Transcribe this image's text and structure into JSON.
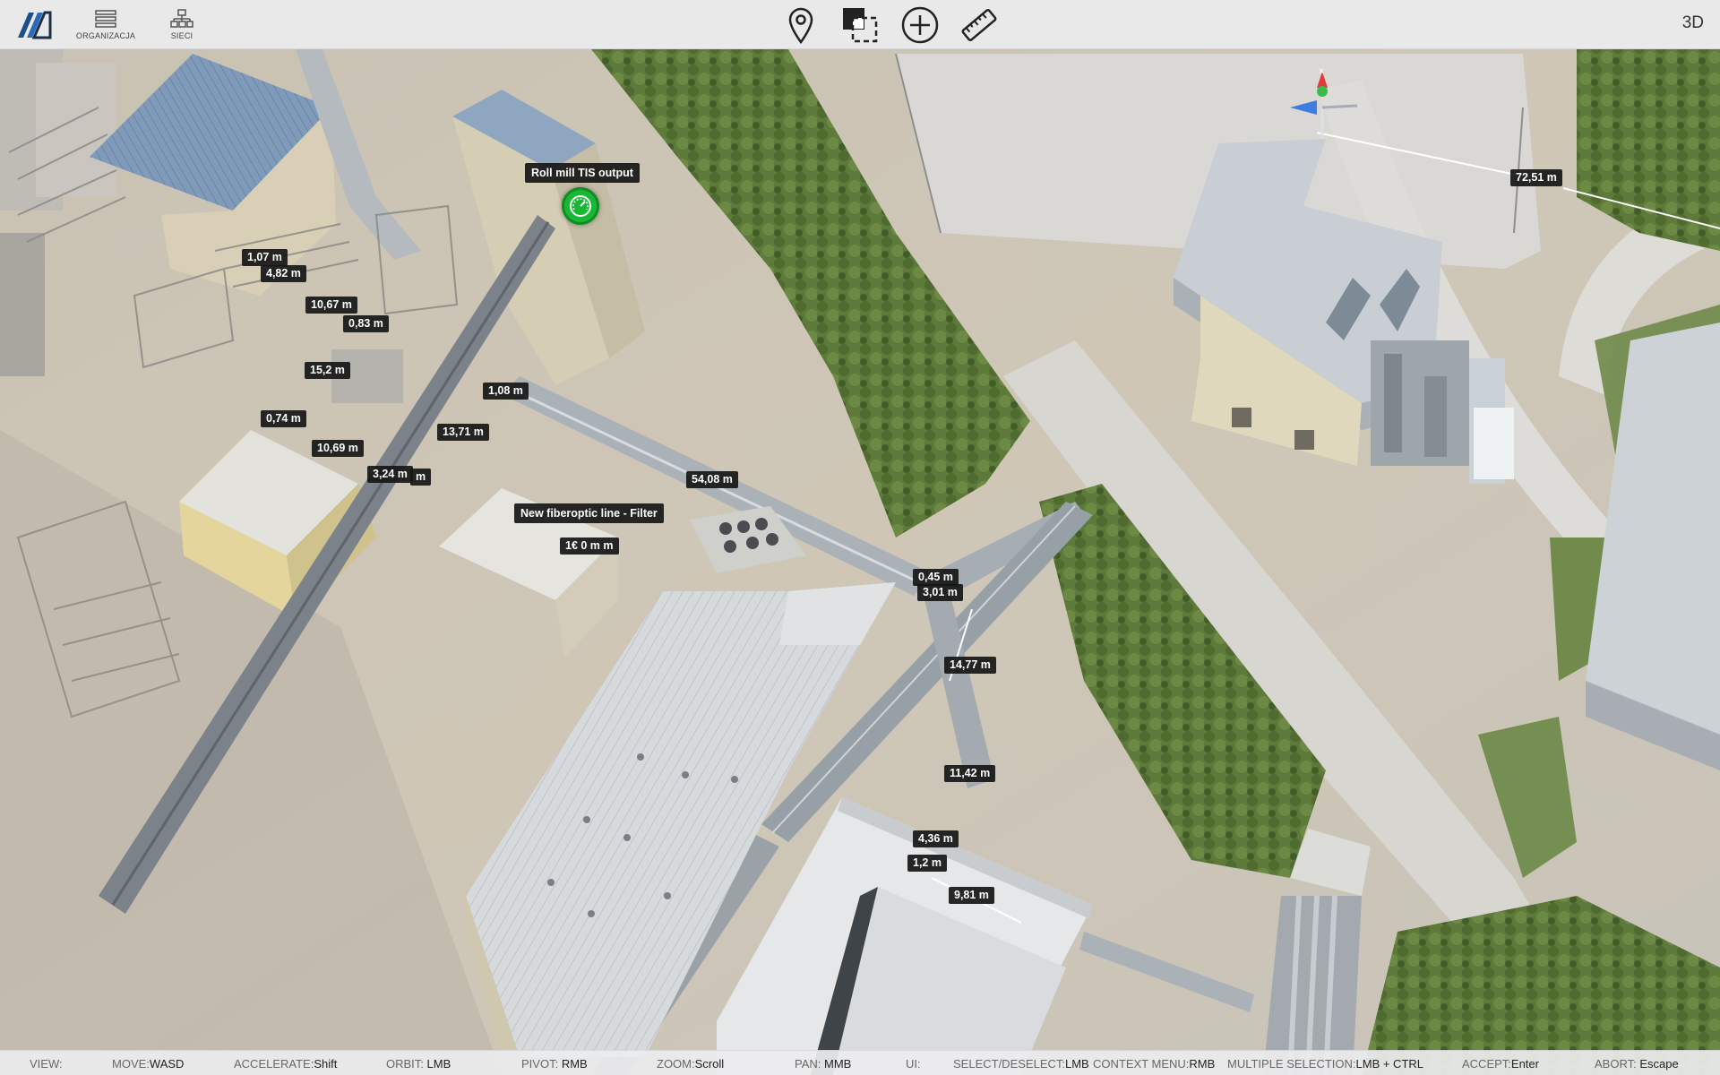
{
  "toolbar": {
    "left_buttons": [
      {
        "label": "ORGANIZACJA",
        "icon": "list-icon"
      },
      {
        "label": "SIECI",
        "icon": "network-icon"
      }
    ],
    "tools": [
      "map-pin-icon",
      "select-area-icon",
      "add-icon",
      "ruler-icon"
    ],
    "view_mode": "3D"
  },
  "points_of_interest": [
    {
      "label": "Roll mill TIS output",
      "icon": "gauge-icon",
      "color": "#19b834"
    },
    {
      "label": "New fiberoptic line - Filter"
    }
  ],
  "measurements": [
    "1,07 m",
    "4,82 m",
    "10,67 m",
    "0,83 m",
    "15,2 m",
    "1,08 m",
    "0,74 m",
    "10,69 m",
    "13,71 m",
    "3,24 m",
    "m",
    "54,08 m",
    "1€ 0 m m",
    "0,45 m",
    "3,01 m",
    "14,77 m",
    "11,42 m",
    "4,36 m",
    "1,2 m",
    "9,81 m",
    "72,51 m"
  ],
  "status_bar": {
    "view": "VIEW:",
    "move_key": "MOVE:",
    "move_val": "WASD",
    "accelerate_key": "ACCELERATE:",
    "accelerate_val": "Shift",
    "orbit_key": "ORBIT:",
    "orbit_val": "LMB",
    "pivot_key": "PIVOT:",
    "pivot_val": "RMB",
    "zoom_key": "ZOOM:",
    "zoom_val": "Scroll",
    "pan_key": "PAN:",
    "pan_val": "MMB",
    "ui": "UI:",
    "select_key": "SELECT/DESELECT:",
    "select_val": "LMB",
    "context_key": "CONTEXT MENU:",
    "context_val": "RMB",
    "multi_key": "MULTIPLE SELECTION:",
    "multi_val": "LMB + CTRL",
    "accept_key": "ACCEPT:",
    "accept_val": "Enter",
    "abort_key": "ABORT:",
    "abort_val": "Escape"
  },
  "colors": {
    "vegetation": "#5f7a3c",
    "roof": "#d9dde1",
    "ground": "#cfc7b8",
    "toolbar": "#ececee"
  }
}
